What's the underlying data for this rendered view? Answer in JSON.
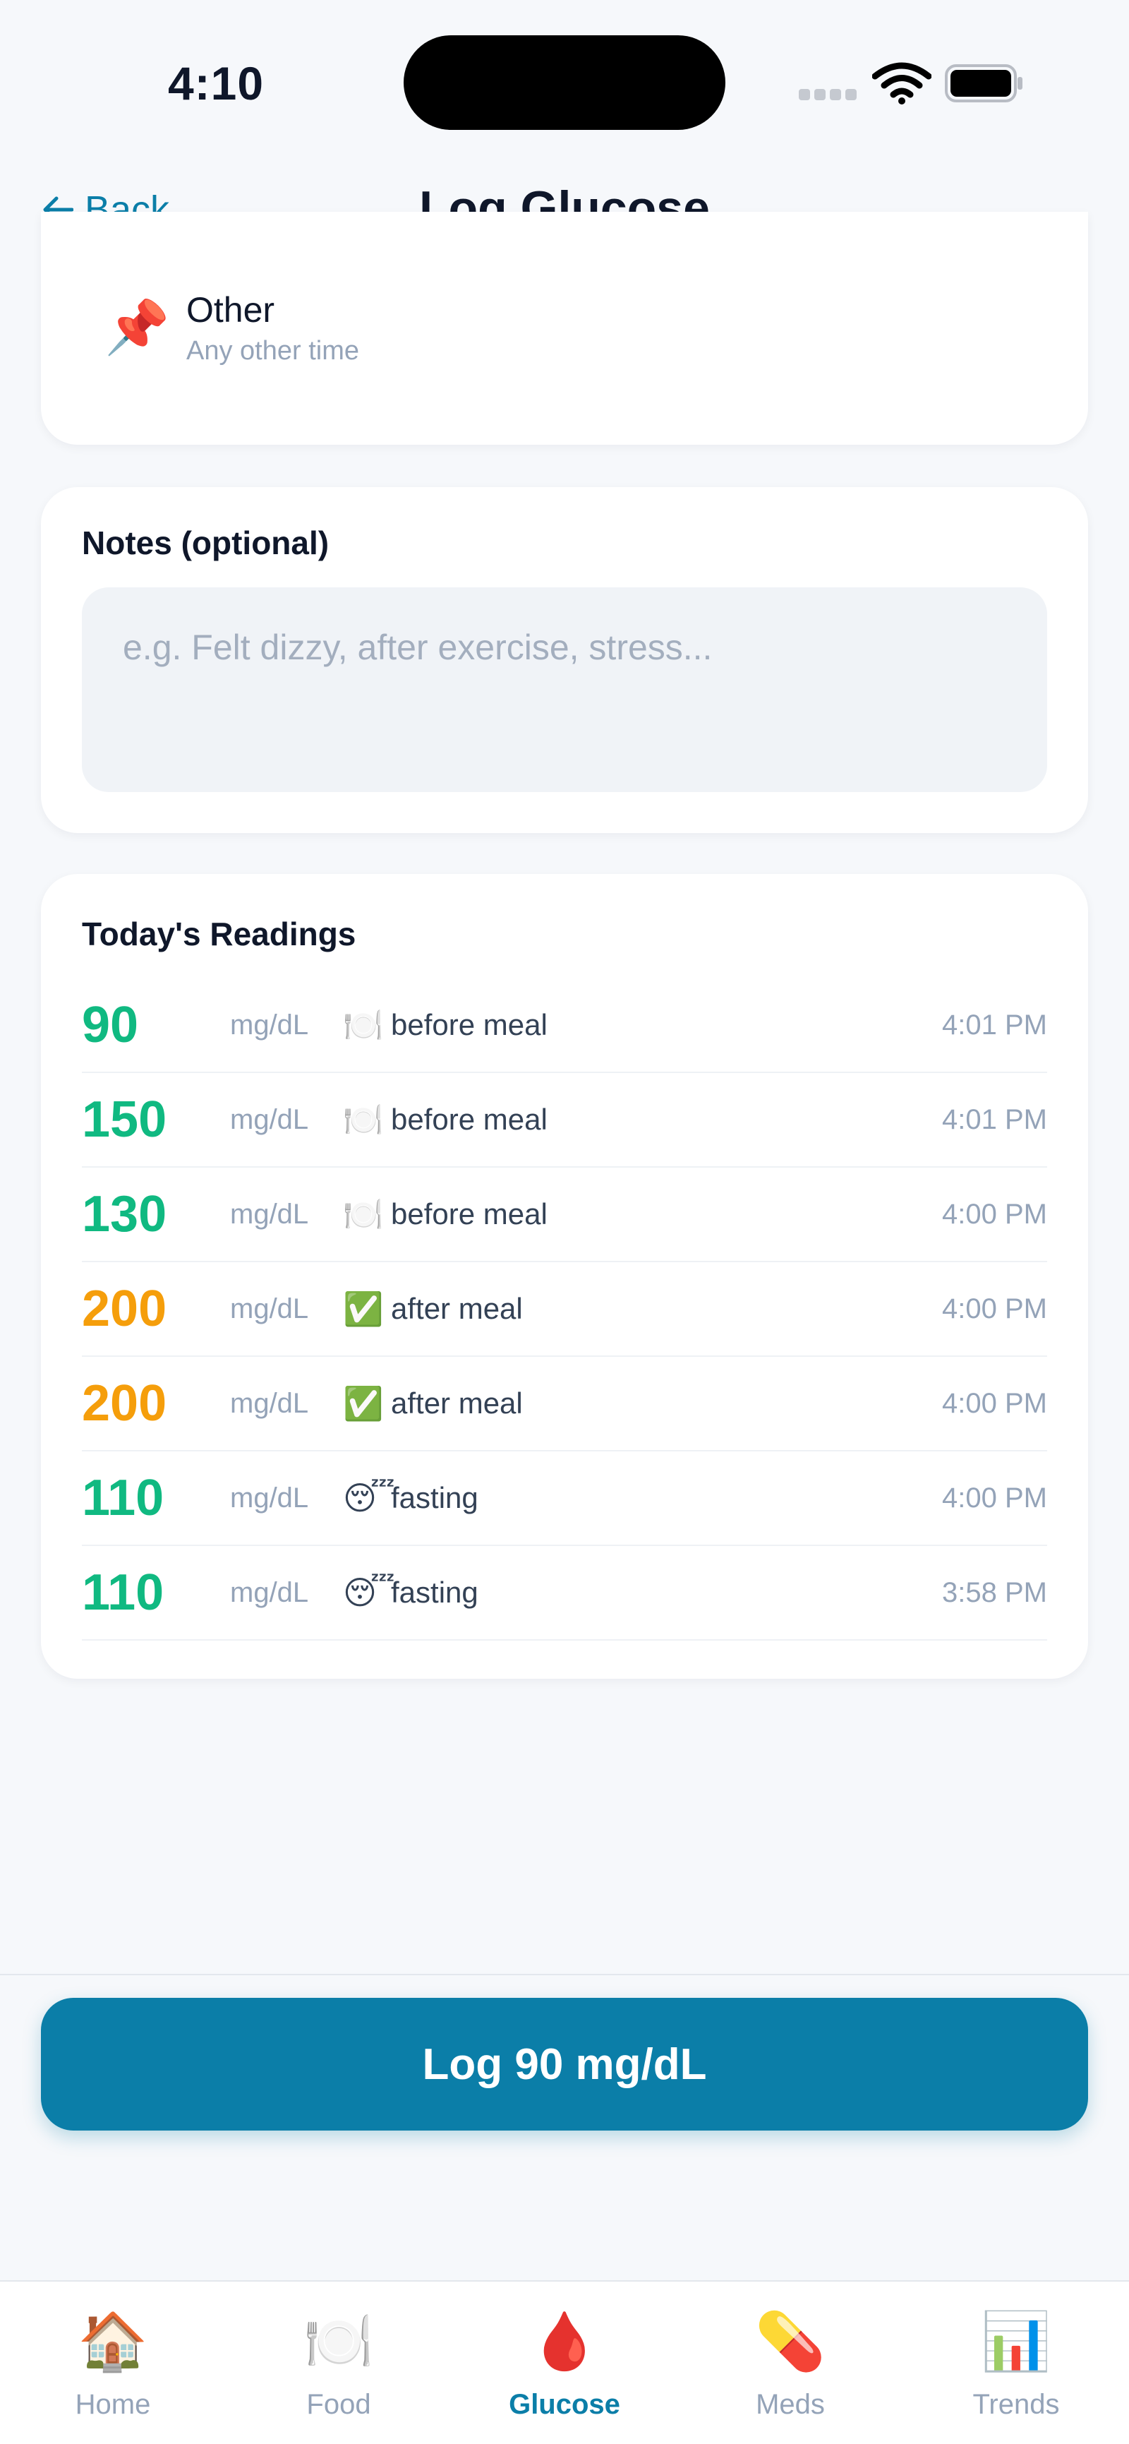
{
  "status_bar": {
    "time": "4:10"
  },
  "nav": {
    "back_label": "Back",
    "title": "Log Glucose"
  },
  "meal_option": {
    "icon": "pushpin-icon",
    "glyph": "📌",
    "title": "Other",
    "subtitle": "Any other time"
  },
  "notes": {
    "label": "Notes (optional)",
    "placeholder": "e.g. Felt dizzy, after exercise, stress...",
    "value": ""
  },
  "readings": {
    "title": "Today's Readings",
    "items": [
      {
        "value": "90",
        "unit": "mg/dL",
        "icon": "🍽️",
        "tag": "before meal",
        "time": "4:01 PM",
        "status": "ok"
      },
      {
        "value": "150",
        "unit": "mg/dL",
        "icon": "🍽️",
        "tag": "before meal",
        "time": "4:01 PM",
        "status": "ok"
      },
      {
        "value": "130",
        "unit": "mg/dL",
        "icon": "🍽️",
        "tag": "before meal",
        "time": "4:00 PM",
        "status": "ok"
      },
      {
        "value": "200",
        "unit": "mg/dL",
        "icon": "✅",
        "tag": "after meal",
        "time": "4:00 PM",
        "status": "high"
      },
      {
        "value": "200",
        "unit": "mg/dL",
        "icon": "✅",
        "tag": "after meal",
        "time": "4:00 PM",
        "status": "high"
      },
      {
        "value": "110",
        "unit": "mg/dL",
        "icon": "😴",
        "tag": "fasting",
        "time": "4:00 PM",
        "status": "ok"
      },
      {
        "value": "110",
        "unit": "mg/dL",
        "icon": "😴",
        "tag": "fasting",
        "time": "3:58 PM",
        "status": "ok"
      }
    ]
  },
  "action": {
    "log_label": "Log 90 mg/dL"
  },
  "tabs": [
    {
      "label": "Home",
      "icon": "🏠",
      "active": false
    },
    {
      "label": "Food",
      "icon": "🍽️",
      "active": false
    },
    {
      "label": "Glucose",
      "icon": "🩸",
      "active": true
    },
    {
      "label": "Meds",
      "icon": "💊",
      "active": false
    },
    {
      "label": "Trends",
      "icon": "📊",
      "active": false
    }
  ],
  "colors": {
    "accent": "#0b7ea8",
    "in_range": "#10b981",
    "elevated": "#f59e0b",
    "muted": "#94a3b8"
  }
}
